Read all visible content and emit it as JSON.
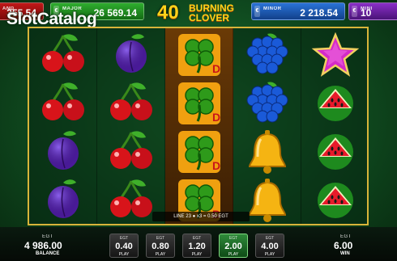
{
  "jackpots": [
    {
      "level": "GRAND",
      "value": "355.54",
      "label_shown": "AND"
    },
    {
      "level": "MAJOR",
      "value": "26 569.14"
    },
    {
      "level": "MINOR",
      "value": "2 218.54"
    },
    {
      "level": "MINI",
      "value": "10"
    }
  ],
  "game_title": {
    "number": "40",
    "line1": "BURNING",
    "line2": "CLOVER"
  },
  "watermark": "SlotCatalog",
  "reels": [
    [
      "cherry",
      "cherry",
      "plum",
      "plum"
    ],
    [
      "plum",
      "cherry",
      "cherry",
      "cherry"
    ],
    [
      "clover-wild",
      "clover-wild",
      "clover-wild",
      "clover-wild"
    ],
    [
      "grapes",
      "grapes",
      "bell",
      "bell"
    ],
    [
      "star",
      "watermelon",
      "watermelon",
      "watermelon"
    ]
  ],
  "win_line": {
    "text": "LINE 23",
    "multiplier": "x3 = 0.50",
    "currency": "EGT"
  },
  "balance": {
    "currency": "EGT",
    "value": "4 986.00",
    "label": "BALANCE"
  },
  "bets": [
    {
      "currency": "EGT",
      "value": "0.40",
      "label": "PLAY"
    },
    {
      "currency": "EGT",
      "value": "0.80",
      "label": "PLAY"
    },
    {
      "currency": "EGT",
      "value": "1.20",
      "label": "PLAY"
    },
    {
      "currency": "EGT",
      "value": "2.00",
      "label": "PLAY",
      "selected": true
    },
    {
      "currency": "EGT",
      "value": "4.00",
      "label": "PLAY"
    }
  ],
  "win": {
    "currency": "EGT",
    "value": "6.00",
    "label": "WIN"
  }
}
